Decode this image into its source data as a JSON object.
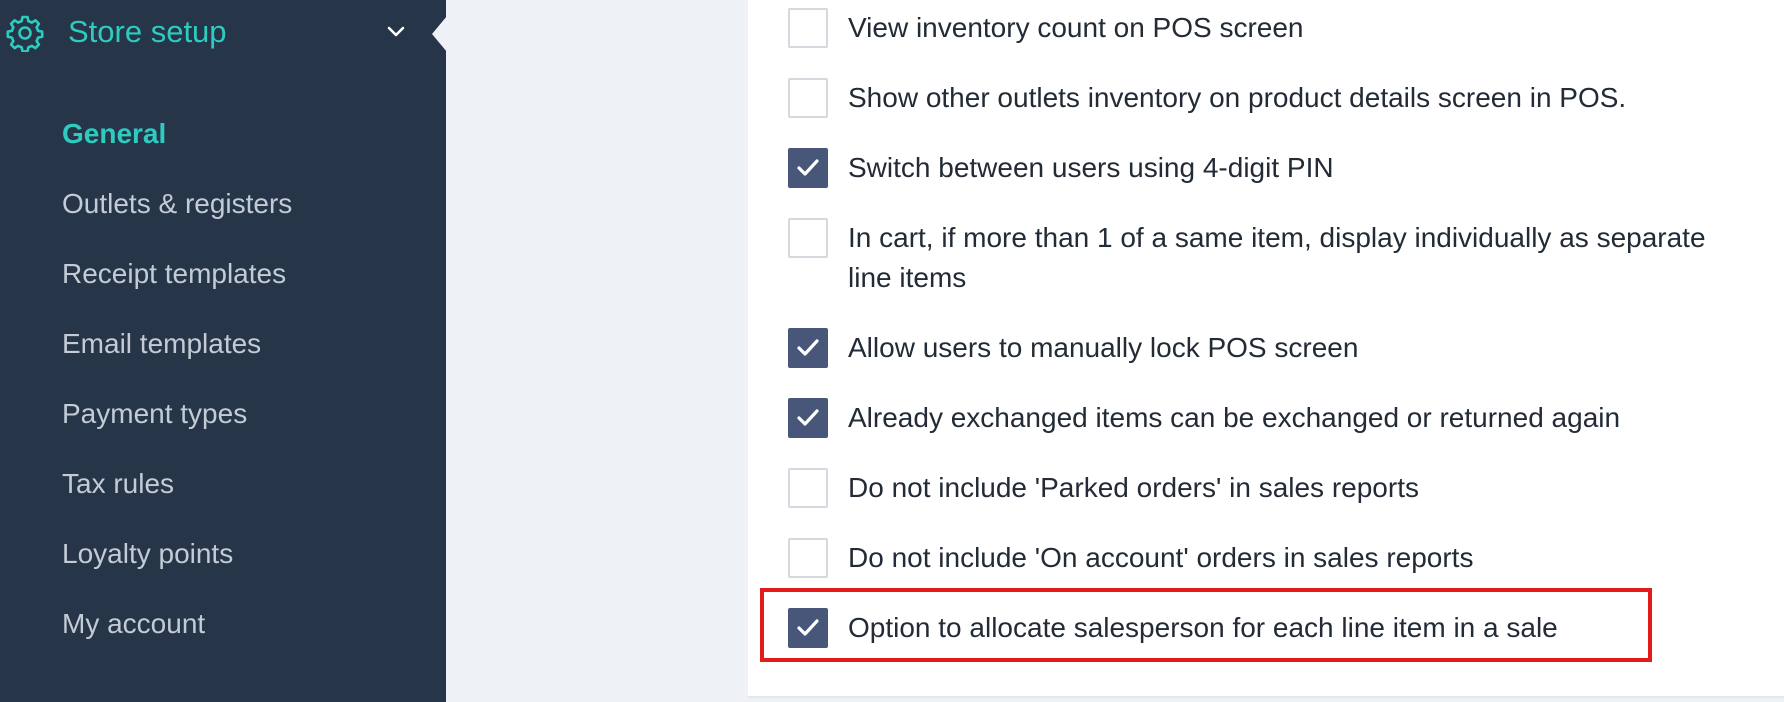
{
  "sidebar": {
    "section_title": "Store setup",
    "section_icon": "gear-icon",
    "expand_icon": "chevron-down-icon",
    "items": [
      {
        "label": "General",
        "active": true
      },
      {
        "label": "Outlets & registers",
        "active": false
      },
      {
        "label": "Receipt templates",
        "active": false
      },
      {
        "label": "Email templates",
        "active": false
      },
      {
        "label": "Payment types",
        "active": false
      },
      {
        "label": "Tax rules",
        "active": false
      },
      {
        "label": "Loyalty points",
        "active": false
      },
      {
        "label": "My account",
        "active": false
      }
    ]
  },
  "settings": {
    "options": [
      {
        "label": "View inventory count on POS screen",
        "checked": false
      },
      {
        "label": "Show other outlets inventory on product details screen in POS.",
        "checked": false
      },
      {
        "label": "Switch between users using 4-digit PIN",
        "checked": true
      },
      {
        "label": "In cart, if more than 1 of a same item, display individually as separate line items",
        "checked": false
      },
      {
        "label": "Allow users to manually lock POS screen",
        "checked": true
      },
      {
        "label": "Already exchanged items can be exchanged or returned again",
        "checked": true
      },
      {
        "label": "Do not include 'Parked orders' in sales reports",
        "checked": false
      },
      {
        "label": "Do not include 'On account' orders in sales reports",
        "checked": false
      },
      {
        "label": "Option to allocate salesperson for each line item in a sale",
        "checked": true
      }
    ]
  },
  "colors": {
    "sidebar_bg": "#263548",
    "accent": "#2dcbc0",
    "checkbox_checked": "#485779",
    "highlight_border": "#e51a1a"
  }
}
